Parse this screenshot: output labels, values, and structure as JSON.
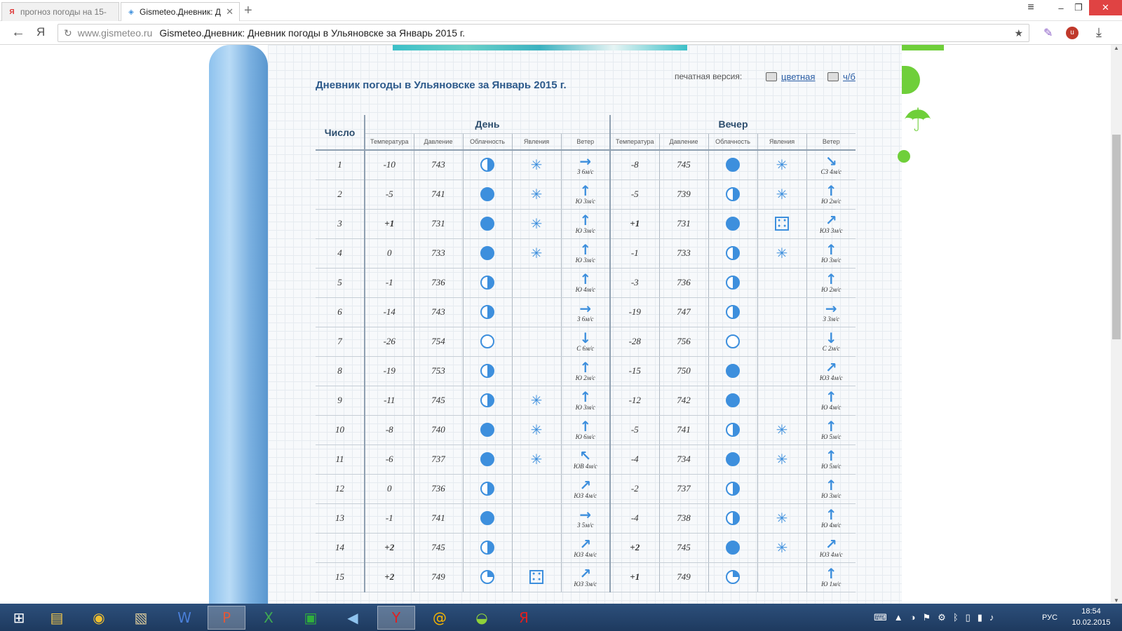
{
  "browser": {
    "tabs": [
      {
        "label": "прогноз погоды на 15-",
        "favicon": "Я"
      },
      {
        "label": "Gismeteo.Дневник: Д",
        "favicon": "💧"
      }
    ],
    "address": {
      "host": "www.gismeteo.ru",
      "title": "Gismeteo.Дневник: Дневник погоды в Ульяновске за Январь 2015 г."
    }
  },
  "page": {
    "title": "Дневник погоды в Ульяновске за Январь 2015 г.",
    "print_label": "печатная версия:",
    "print_color": "цветная",
    "print_bw": "ч/б"
  },
  "table": {
    "num_header": "Число",
    "day_header": "День",
    "evening_header": "Вечер",
    "columns": [
      "Температура",
      "Давление",
      "Облачность",
      "Явления",
      "Ветер"
    ],
    "rows": [
      {
        "n": "1",
        "dt": "-10",
        "dp": "743",
        "dc": "half",
        "dph": "snow",
        "dwa": "→",
        "dw": "З 6м/с",
        "et": "-8",
        "ep": "745",
        "ec": "full",
        "eph": "snow",
        "ewa": "↘",
        "ew": "СЗ 4м/с"
      },
      {
        "n": "2",
        "dt": "-5",
        "dp": "741",
        "dc": "full",
        "dph": "snow",
        "dwa": "↑",
        "dw": "Ю 3м/с",
        "et": "-5",
        "ep": "739",
        "ec": "half",
        "eph": "snow",
        "ewa": "↑",
        "ew": "Ю 2м/с"
      },
      {
        "n": "3",
        "dt": "+1",
        "dp": "731",
        "dc": "full",
        "dph": "snow",
        "dwa": "↑",
        "dw": "Ю 3м/с",
        "et": "+1",
        "ep": "731",
        "ec": "full",
        "eph": "hail",
        "ewa": "↗",
        "ew": "ЮЗ 3м/с"
      },
      {
        "n": "4",
        "dt": "0",
        "dp": "733",
        "dc": "full",
        "dph": "snow",
        "dwa": "↑",
        "dw": "Ю 3м/с",
        "et": "-1",
        "ep": "733",
        "ec": "half",
        "eph": "snow",
        "ewa": "↑",
        "ew": "Ю 3м/с"
      },
      {
        "n": "5",
        "dt": "-1",
        "dp": "736",
        "dc": "half",
        "dph": "",
        "dwa": "↑",
        "dw": "Ю 4м/с",
        "et": "-3",
        "ep": "736",
        "ec": "half",
        "eph": "",
        "ewa": "↑",
        "ew": "Ю 2м/с"
      },
      {
        "n": "6",
        "dt": "-14",
        "dp": "743",
        "dc": "half",
        "dph": "",
        "dwa": "→",
        "dw": "З 6м/с",
        "et": "-19",
        "ep": "747",
        "ec": "half",
        "eph": "",
        "ewa": "→",
        "ew": "З 3м/с"
      },
      {
        "n": "7",
        "dt": "-26",
        "dp": "754",
        "dc": "clear",
        "dph": "",
        "dwa": "↓",
        "dw": "С 6м/с",
        "et": "-28",
        "ep": "756",
        "ec": "clear",
        "eph": "",
        "ewa": "↓",
        "ew": "С 2м/с"
      },
      {
        "n": "8",
        "dt": "-19",
        "dp": "753",
        "dc": "half",
        "dph": "",
        "dwa": "↑",
        "dw": "Ю 2м/с",
        "et": "-15",
        "ep": "750",
        "ec": "full",
        "eph": "",
        "ewa": "↗",
        "ew": "ЮЗ 4м/с"
      },
      {
        "n": "9",
        "dt": "-11",
        "dp": "745",
        "dc": "half",
        "dph": "snow",
        "dwa": "↑",
        "dw": "Ю 3м/с",
        "et": "-12",
        "ep": "742",
        "ec": "full",
        "eph": "",
        "ewa": "↑",
        "ew": "Ю 4м/с"
      },
      {
        "n": "10",
        "dt": "-8",
        "dp": "740",
        "dc": "full",
        "dph": "snow",
        "dwa": "↑",
        "dw": "Ю 6м/с",
        "et": "-5",
        "ep": "741",
        "ec": "half",
        "eph": "snow",
        "ewa": "↑",
        "ew": "Ю 5м/с"
      },
      {
        "n": "11",
        "dt": "-6",
        "dp": "737",
        "dc": "full",
        "dph": "snow",
        "dwa": "↖",
        "dw": "ЮВ 4м/с",
        "et": "-4",
        "ep": "734",
        "ec": "full",
        "eph": "snow",
        "ewa": "↑",
        "ew": "Ю 5м/с"
      },
      {
        "n": "12",
        "dt": "0",
        "dp": "736",
        "dc": "half",
        "dph": "",
        "dwa": "↗",
        "dw": "ЮЗ 4м/с",
        "et": "-2",
        "ep": "737",
        "ec": "half",
        "eph": "",
        "ewa": "↑",
        "ew": "Ю 3м/с"
      },
      {
        "n": "13",
        "dt": "-1",
        "dp": "741",
        "dc": "full",
        "dph": "",
        "dwa": "→",
        "dw": "З 5м/с",
        "et": "-4",
        "ep": "738",
        "ec": "half",
        "eph": "snow",
        "ewa": "↑",
        "ew": "Ю 4м/с"
      },
      {
        "n": "14",
        "dt": "+2",
        "dp": "745",
        "dc": "half",
        "dph": "",
        "dwa": "↗",
        "dw": "ЮЗ 4м/с",
        "et": "+2",
        "ep": "745",
        "ec": "full",
        "eph": "snow",
        "ewa": "↗",
        "ew": "ЮЗ 4м/с"
      },
      {
        "n": "15",
        "dt": "+2",
        "dp": "749",
        "dc": "quarter",
        "dph": "hail",
        "dwa": "↗",
        "dw": "ЮЗ 3м/с",
        "et": "+1",
        "ep": "749",
        "ec": "quarter",
        "eph": "",
        "ewa": "↑",
        "ew": "Ю 1м/с"
      }
    ]
  },
  "taskbar": {
    "lang": "РУС",
    "time": "18:54",
    "date": "10.02.2015"
  },
  "colors": {
    "accent": "#3d8fdd",
    "title": "#2d5a8b",
    "positive_temp": "#d02020"
  }
}
